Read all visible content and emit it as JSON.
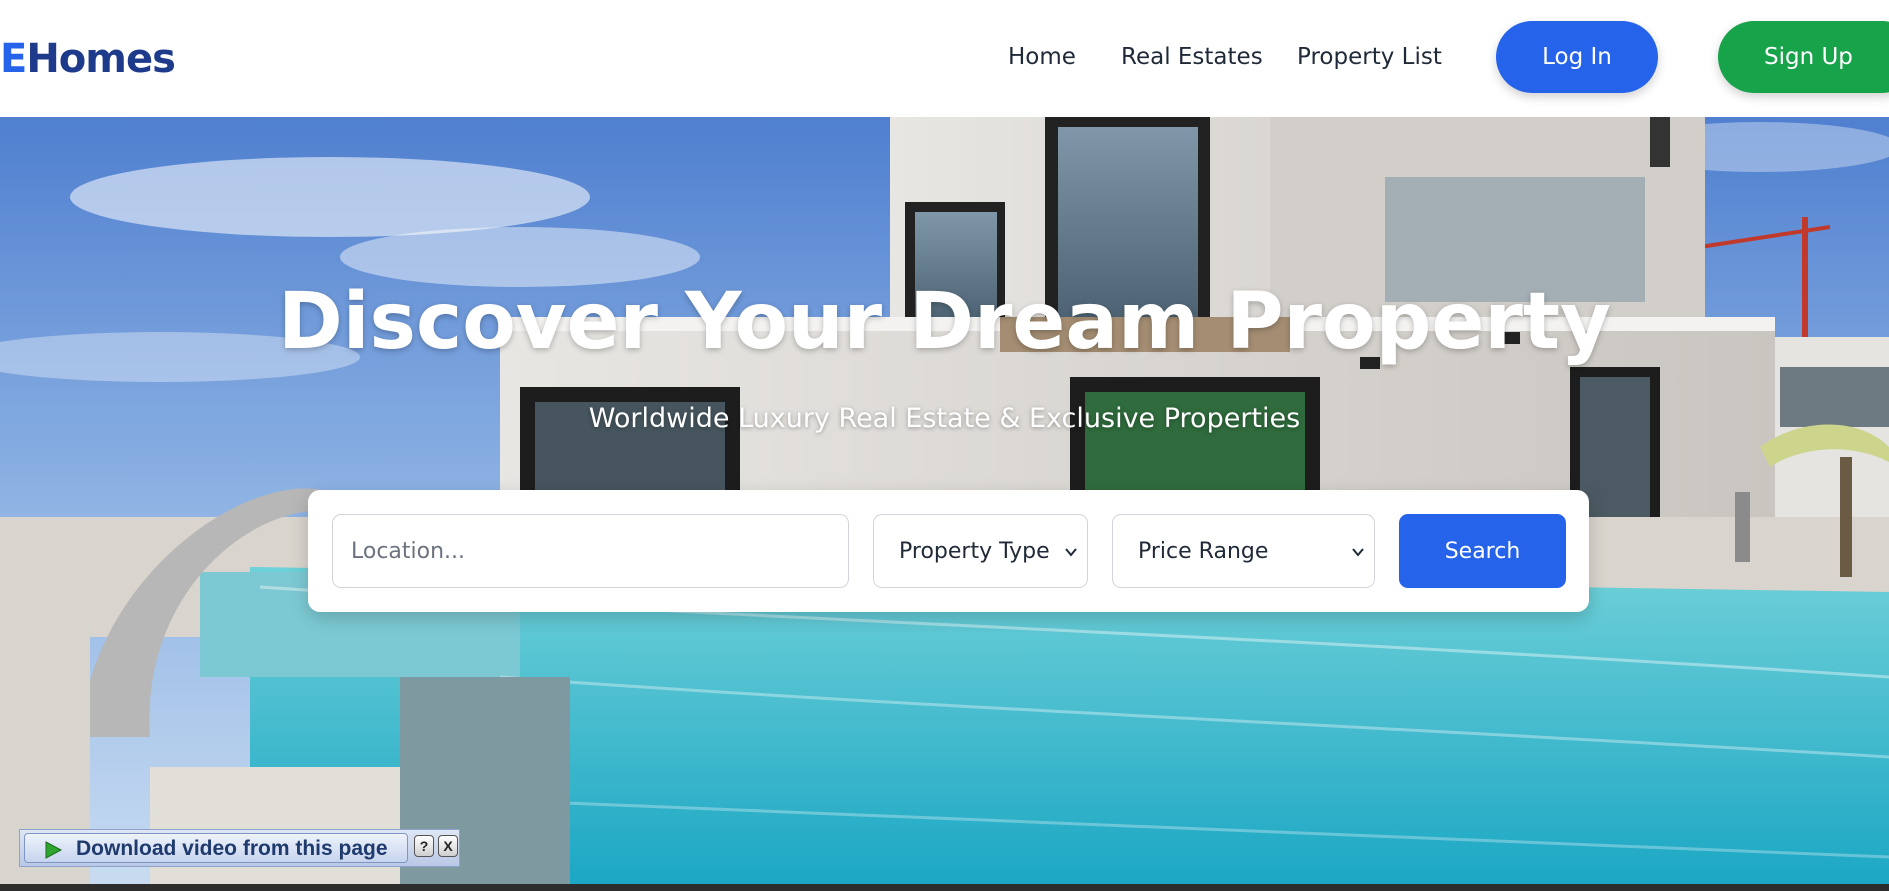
{
  "header": {
    "logo_prefix": "E",
    "logo_rest": "Homes",
    "nav": [
      {
        "label": "Home"
      },
      {
        "label": "Real Estates"
      },
      {
        "label": "Property List"
      }
    ],
    "login_label": "Log In",
    "signup_label": "Sign Up"
  },
  "hero": {
    "title": "Discover Your Dream Property",
    "subtitle": "Worldwide Luxury Real Estate & Exclusive Properties",
    "search": {
      "location_placeholder": "Location...",
      "property_type": "Property Type",
      "price_range": "Price Range",
      "button_label": "Search"
    }
  },
  "download_bar": {
    "label": "Download video from this page",
    "help": "?",
    "close": "X"
  },
  "colors": {
    "primary": "#2563eb",
    "signup": "#16a34a",
    "logo_dark": "#1e3a8a"
  }
}
